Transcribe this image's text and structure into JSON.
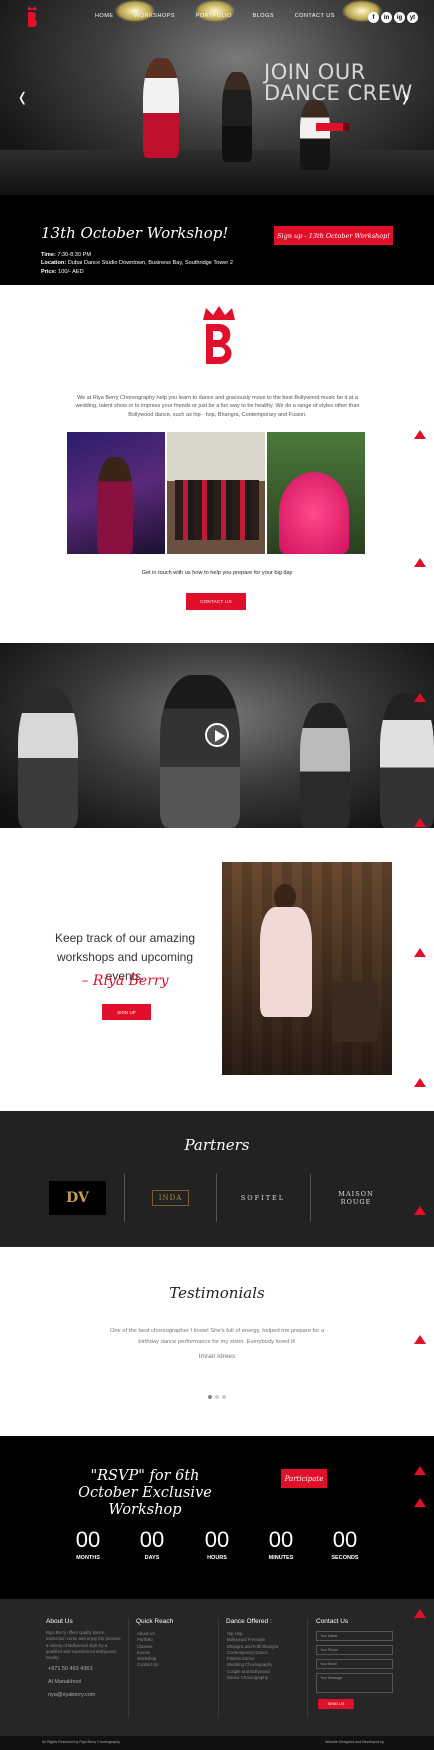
{
  "nav": {
    "items": [
      "HOME",
      "WORKSHOPS",
      "PORTFOLIO",
      "BLOGS",
      "CONTACT US"
    ]
  },
  "social": {
    "icons": [
      "f",
      "in",
      "ig",
      "yt"
    ]
  },
  "hero": {
    "overlay": "JOIN OUR DANCE CREW"
  },
  "workshop": {
    "title": "13th October Workshop!",
    "time_label": "Time:",
    "time": "7:30-8:30 PM",
    "location_label": "Location:",
    "location": "Dubai Dance Studio Downtown, Business Bay, Southridge Tower 2",
    "price_label": "Price:",
    "price": "100/- AED",
    "button": "Sign up - 13th October Workshop!"
  },
  "about": {
    "text": "We at Riya Berry Choreography help you learn to dance and graciously move to the best Bollywood music be it at a wedding, talent show or to impress your friends or just be a fun way to be healthy. We do a range of styles other than Bollywood dance, such as hip - hop, Bhangra, Contemporary and Fusion.",
    "get_in_touch": "Get in touch with us how to help you prepare for your big day",
    "contact_button": "CONTACT US"
  },
  "track": {
    "text": "Keep track of our amazing workshops and upcoming events.",
    "signature": "– Riya Berry",
    "button": "SIGN UP"
  },
  "partners": {
    "title": "Partners",
    "logos": [
      "DV",
      "INDA",
      "SOFITEL",
      "MAISON ROUGE"
    ]
  },
  "testimonials": {
    "title": "Testimonials",
    "quote": "One of the best choreographer I know! She's full of energy, helped me prepare for a birthday dance performance for my sister. Everybody loved it!",
    "author": "Imran Idrees"
  },
  "rsvp": {
    "title": "\"RSVP\" for 6th October Exclusive Workshop",
    "button": "Participate",
    "countdown": [
      {
        "value": "00",
        "label": "MONTHS"
      },
      {
        "value": "00",
        "label": "DAYS"
      },
      {
        "value": "00",
        "label": "HOURS"
      },
      {
        "value": "00",
        "label": "MINUTES"
      },
      {
        "value": "00",
        "label": "SECONDS"
      }
    ]
  },
  "footer": {
    "about_title": "About Us",
    "about_text": "Riya Berry offers quality dance instruction come and enjoy the process a variety of Bollywood style by a qualified and experienced Bollywood faculty.",
    "phone": "+971 50 463 4363",
    "city": "Al Manakhool",
    "email": "riya@riyaberry.com",
    "quick_title": "Quick Reach",
    "quick_links": [
      "About Us",
      "Portfolio",
      "Classes",
      "Events",
      "Workshop",
      "Contact Us"
    ],
    "dance_title": "Dance Offered :",
    "dance_links": [
      "Hip Hop",
      "Bollywood Freestyle",
      "Bhangra and Folk Bhangra",
      "Contemporary Dance",
      "Fitness Dance",
      "Wedding Choreography",
      "Couple and Bollywood Dance Choreography"
    ],
    "contact_title": "Contact Us",
    "form_placeholders": [
      "Your Name",
      "Your Phone",
      "Your Email",
      "Your Message"
    ],
    "send": "SEND US",
    "copyright": "All Rights Reserved by Riya Berry Choreography",
    "credit": "Website Designed and Developed by"
  },
  "colors": {
    "accent": "#e0102a",
    "dark": "#222222"
  }
}
